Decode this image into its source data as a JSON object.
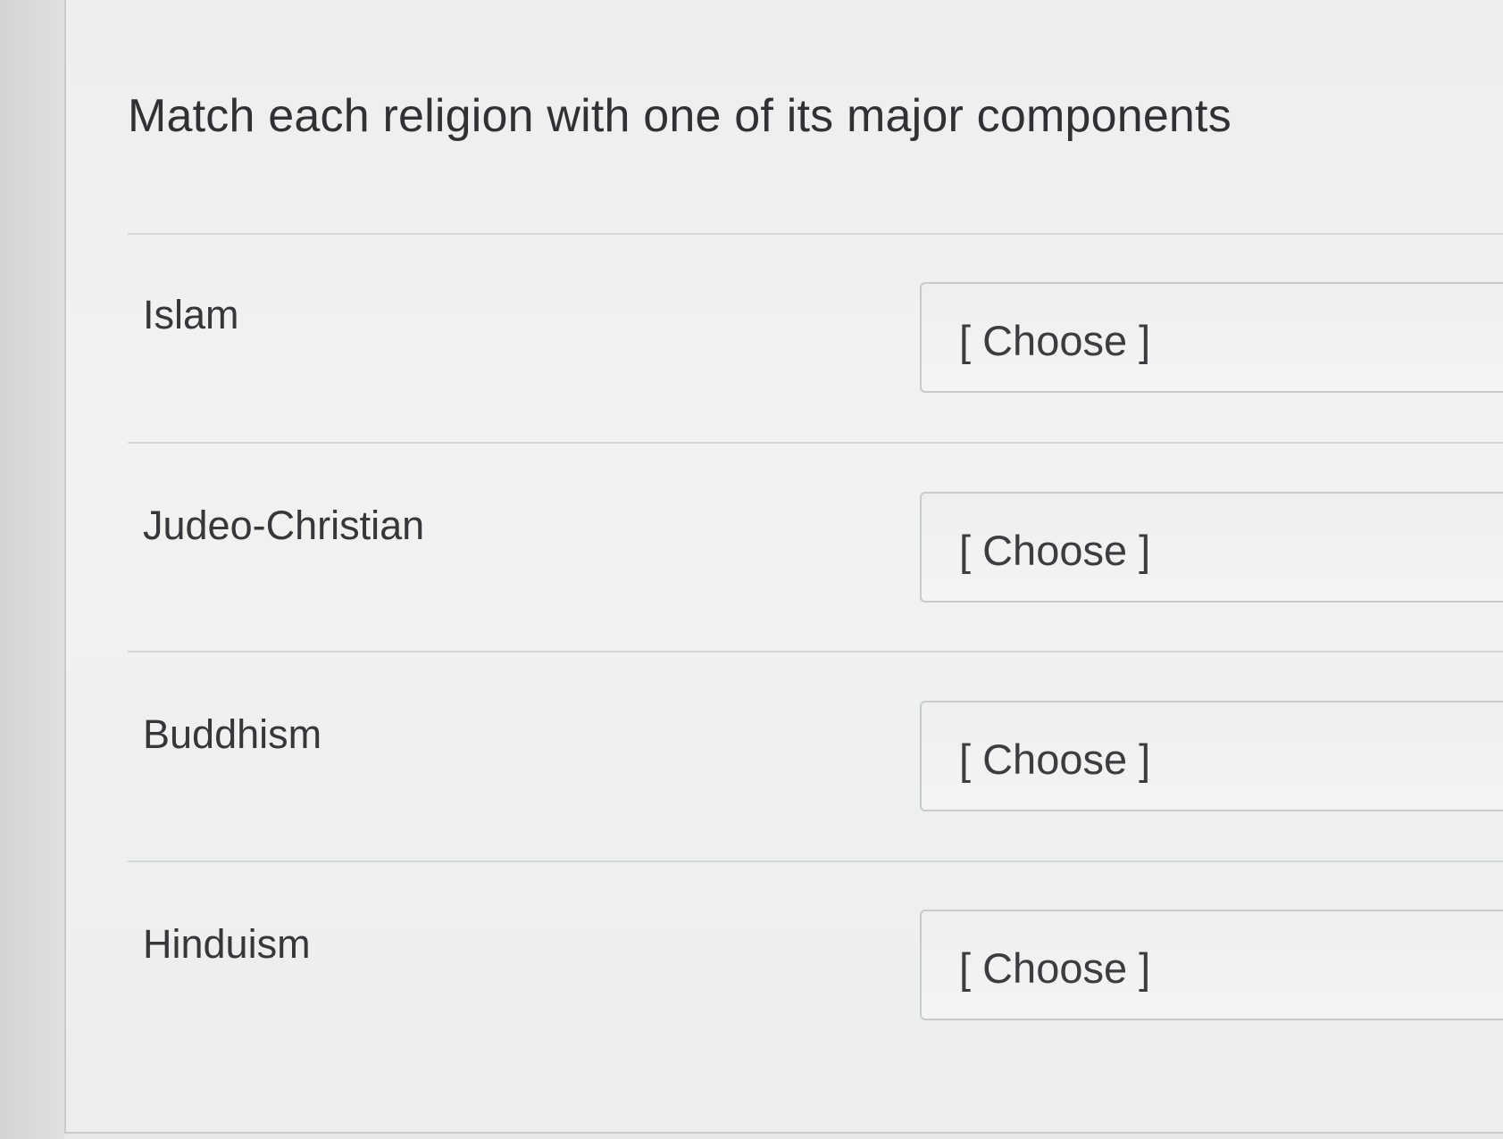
{
  "question": {
    "text": "Match each religion with one of its major components"
  },
  "matches": [
    {
      "label": "Islam",
      "selected": "[ Choose ]"
    },
    {
      "label": "Judeo-Christian",
      "selected": "[ Choose ]"
    },
    {
      "label": "Buddhism",
      "selected": "[ Choose ]"
    },
    {
      "label": "Hinduism",
      "selected": "[ Choose ]"
    }
  ]
}
